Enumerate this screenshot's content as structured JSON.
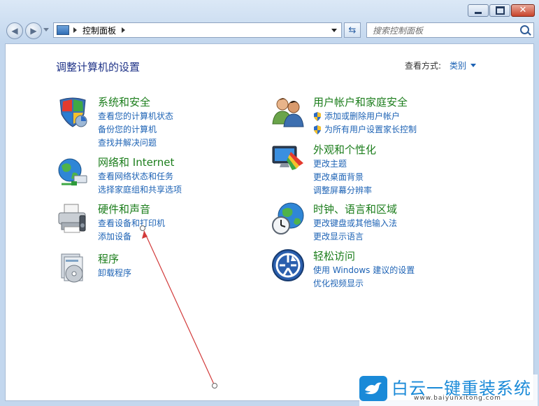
{
  "address": {
    "crumb": "控制面板"
  },
  "search": {
    "placeholder": "搜索控制面板"
  },
  "header": {
    "title": "调整计算机的设置",
    "view_by_label": "查看方式:",
    "view_by_value": "类别"
  },
  "categories": [
    {
      "title": "系统和安全",
      "icon": "shield-icon",
      "links": [
        "查看您的计算机状态",
        "备份您的计算机",
        "查找并解决问题"
      ]
    },
    {
      "title": "网络和 Internet",
      "icon": "globe-network-icon",
      "links": [
        "查看网络状态和任务",
        "选择家庭组和共享选项"
      ]
    },
    {
      "title": "硬件和声音",
      "icon": "printer-icon",
      "links": [
        "查看设备和打印机",
        "添加设备"
      ]
    },
    {
      "title": "程序",
      "icon": "programs-icon",
      "links": [
        "卸载程序"
      ]
    },
    {
      "title": "用户帐户和家庭安全",
      "icon": "users-icon",
      "links": [
        "添加或删除用户帐户",
        "为所有用户设置家长控制"
      ]
    },
    {
      "title": "外观和个性化",
      "icon": "monitor-icon",
      "links": [
        "更改主题",
        "更改桌面背景",
        "调整屏幕分辨率"
      ]
    },
    {
      "title": "时钟、语言和区域",
      "icon": "clock-globe-icon",
      "links": [
        "更改键盘或其他输入法",
        "更改显示语言"
      ]
    },
    {
      "title": "轻松访问",
      "icon": "ease-of-access-icon",
      "links": [
        "使用 Windows 建议的设置",
        "优化视频显示"
      ]
    }
  ],
  "watermark": {
    "brand": "白云一键重装系统",
    "url": "www.baiyunxitong.com"
  },
  "colors": {
    "link": "#1e63b5",
    "category_title": "#1b7d1b",
    "heading": "#1e3287",
    "annotation": "#d23a3a"
  }
}
